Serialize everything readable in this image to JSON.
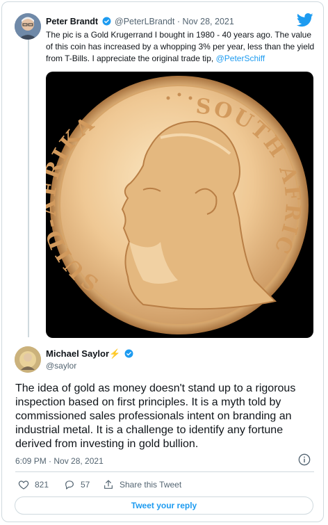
{
  "quoted_tweet": {
    "author_name": "Peter Brandt",
    "handle_date": "@PeterLBrandt · Nov 28, 2021",
    "text": "The pic is a Gold Krugerrand I bought in 1980 - 40 years ago. The value of this coin has increased by a whopping 3% per year, less than the yield from T-Bills. I appreciate the original trade tip,",
    "mention": "@PeterSchiff",
    "image": {
      "top_text": "SOUTH AFRICA",
      "left_text": "SUID-AFRIKA",
      "icon": "gold-coin-image"
    }
  },
  "reply_tweet": {
    "author_name": "Michael Saylor⚡",
    "handle": "@saylor",
    "text": "The idea of gold as money doesn't stand up to a rigorous inspection based on first principles. It is a myth told by commissioned sales professionals intent on branding an industrial metal. It is a challenge to identify any fortune derived from investing in gold bullion.",
    "timestamp": "6:09 PM · Nov 28, 2021"
  },
  "actions": {
    "likes": "821",
    "replies": "57",
    "share_label": "Share this Tweet"
  },
  "reply_button_label": "Tweet your reply",
  "colors": {
    "accent": "#1d9bf0",
    "text": "#0f1419",
    "muted": "#536471",
    "border": "#cfd9de"
  }
}
